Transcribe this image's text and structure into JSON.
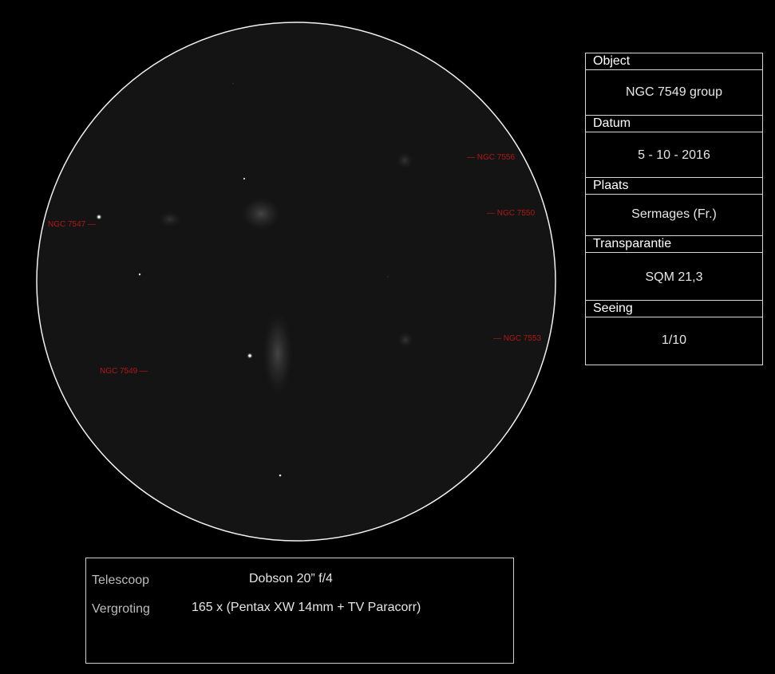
{
  "sketch": {
    "labels": {
      "ngc7547": "NGC 7547 —",
      "ngc7549": "NGC 7549 —",
      "ngc7556": "— NGC 7556",
      "ngc7550": "— NGC 7550",
      "ngc7553": "— NGC 7553"
    },
    "colors": {
      "background": "#000000",
      "field": "#141414",
      "circle": "#f2f2f2",
      "label": "#b01818"
    }
  },
  "info": {
    "object_label": "Object",
    "object_value": "NGC 7549 group",
    "datum_label": "Datum",
    "datum_value": "5 - 10 - 2016",
    "plaats_label": "Plaats",
    "plaats_value": "Sermages (Fr.)",
    "transparantie_label": "Transparantie",
    "transparantie_value": "SQM 21,3",
    "seeing_label": "Seeing",
    "seeing_value": "1/10"
  },
  "equipment": {
    "telescope_label": "Telescoop",
    "telescope_value": "Dobson 20” f/4",
    "magnification_label": "Vergroting",
    "magnification_value": "165 x (Pentax XW 14mm + TV Paracorr)"
  }
}
